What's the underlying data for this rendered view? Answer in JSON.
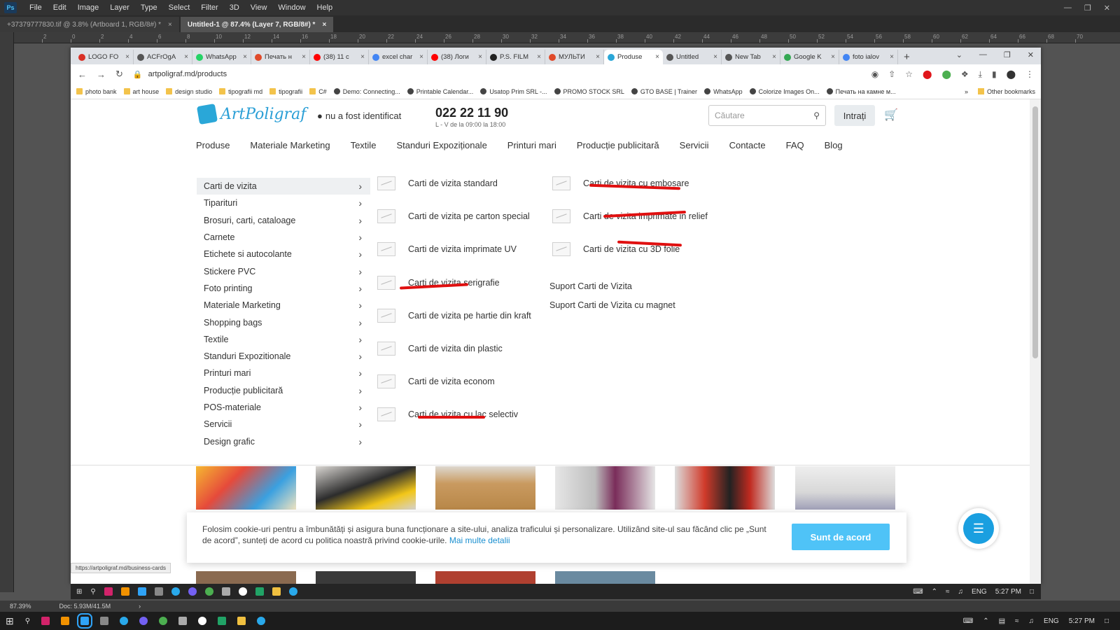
{
  "photoshop": {
    "menu": [
      "File",
      "Edit",
      "Image",
      "Layer",
      "Type",
      "Select",
      "Filter",
      "3D",
      "View",
      "Window",
      "Help"
    ],
    "doc_tabs": [
      {
        "label": "+37379777830.tif @ 3.8% (Artboard 1, RGB/8#) *",
        "active": false
      },
      {
        "label": "Untitled-1 @ 87.4% (Layer 7, RGB/8#) *",
        "active": true
      }
    ],
    "ruler_labels": [
      "2",
      "0",
      "2",
      "4",
      "6",
      "8",
      "10",
      "12",
      "14",
      "16",
      "18",
      "20",
      "22",
      "24",
      "26",
      "28",
      "30",
      "32",
      "34",
      "36",
      "38",
      "40",
      "42",
      "44",
      "46",
      "48",
      "50",
      "52",
      "54",
      "56",
      "58",
      "60",
      "62",
      "64",
      "66",
      "68",
      "70"
    ],
    "zoom": "87.39%",
    "doc_size": "Doc: 5.93M/41.5M"
  },
  "browser": {
    "tabs": [
      {
        "title": "LOGO FO",
        "icon": "gmail-icon",
        "color": "#d93025",
        "active": false
      },
      {
        "title": "ACFrOgA",
        "icon": "globe-icon",
        "color": "#555555",
        "active": false
      },
      {
        "title": "WhatsApp",
        "icon": "whatsapp-icon",
        "color": "#25d366",
        "active": false
      },
      {
        "title": "Печать н",
        "icon": "printer-icon",
        "color": "#e04a2a",
        "active": false
      },
      {
        "title": "(38) 11 с",
        "icon": "youtube-icon",
        "color": "#ff0000",
        "active": false
      },
      {
        "title": "excel char",
        "icon": "google-icon",
        "color": "#4285f4",
        "active": false
      },
      {
        "title": "(38) Логи",
        "icon": "youtube-icon",
        "color": "#ff0000",
        "active": false
      },
      {
        "title": "P.S. FILM",
        "icon": "film-icon",
        "color": "#222222",
        "active": false
      },
      {
        "title": "МУЛЬТИ",
        "icon": "printer-icon",
        "color": "#e04a2a",
        "active": false
      },
      {
        "title": "Produse",
        "icon": "artpoligraf-icon",
        "color": "#2aa7d8",
        "active": true
      },
      {
        "title": "Untitled",
        "icon": "globe-icon",
        "color": "#555555",
        "active": false
      },
      {
        "title": "New Tab",
        "icon": "globe-icon",
        "color": "#555555",
        "active": false
      },
      {
        "title": "Google K",
        "icon": "maps-icon",
        "color": "#34a853",
        "active": false
      },
      {
        "title": "foto ialov",
        "icon": "google-icon",
        "color": "#4285f4",
        "active": false
      }
    ],
    "url": "artpoligraf.md/products",
    "bookmarks": [
      {
        "label": "photo bank",
        "type": "folder"
      },
      {
        "label": "art house",
        "type": "folder"
      },
      {
        "label": "design studio",
        "type": "folder"
      },
      {
        "label": "tipografii md",
        "type": "folder"
      },
      {
        "label": "tipografii",
        "type": "folder"
      },
      {
        "label": "C#",
        "type": "folder"
      },
      {
        "label": "Demo: Connecting...",
        "type": "site"
      },
      {
        "label": "Printable Calendar...",
        "type": "site"
      },
      {
        "label": "Usatop Prim SRL -...",
        "type": "site"
      },
      {
        "label": "PROMO STOCK SRL",
        "type": "site"
      },
      {
        "label": "GTO BASE | Trainer",
        "type": "site"
      },
      {
        "label": "WhatsApp",
        "type": "site"
      },
      {
        "label": "Colorize Images On...",
        "type": "site"
      },
      {
        "label": "Печать на камне м...",
        "type": "site"
      }
    ],
    "other_bookmarks": "Other bookmarks",
    "status_url": "https://artpoligraf.md/business-cards"
  },
  "site": {
    "logo_text": "ArtPoligraf",
    "location": "nu a fost identificat",
    "phone": "022 22 11 90",
    "hours": "L - V de la 09:00 la 18:00",
    "search_placeholder": "Căutare",
    "login": "Intrați",
    "nav": [
      "Produse",
      "Materiale Marketing",
      "Textile",
      "Standuri Expoziționale",
      "Printuri mari",
      "Producție publicitară",
      "Servicii",
      "Contacte",
      "FAQ",
      "Blog"
    ],
    "categories": [
      "Carti de vizita",
      "Tiparituri",
      "Brosuri, carti, cataloage",
      "Carnete",
      "Etichete si autocolante",
      "Stickere PVC",
      "Foto printing",
      "Materiale Marketing",
      "Shopping bags",
      "Textile",
      "Standuri Expozitionale",
      "Printuri mari",
      "Producție publicitară",
      "POS-materiale",
      "Servicii",
      "Design grafic"
    ],
    "subcol1": [
      "Carti de vizita standard",
      "Carti de vizita pe carton special",
      "Carti de vizita imprimate UV",
      "Carti de vizita serigrafie",
      "Carti de vizita pe hartie din kraft",
      "Carti de vizita din plastic",
      "Carti de vizita econom",
      "Carti de vizita cu lac selectiv"
    ],
    "subcol2": [
      "Carti de vizita cu embosare",
      "Carti de vizita imprimate in relief",
      "Carti de vizita cu 3D folie"
    ],
    "subcol2_plain": [
      "Suport Carti de Vizita",
      "Suport Carti de Vizita cu magnet"
    ],
    "cookie_text": "Folosim cookie-uri pentru a îmbunătăți și asigura buna funcționare a site-ului, analiza traficului și personalizare. Utilizând site-ul sau făcând clic pe „Sunt de acord”, sunteți de acord cu politica noastră privind cookie-urile.",
    "cookie_link": "Mai multe detalii",
    "cookie_button": "Sunt de acord"
  },
  "taskbar": {
    "lang": "ENG",
    "time": "5:27 PM"
  }
}
